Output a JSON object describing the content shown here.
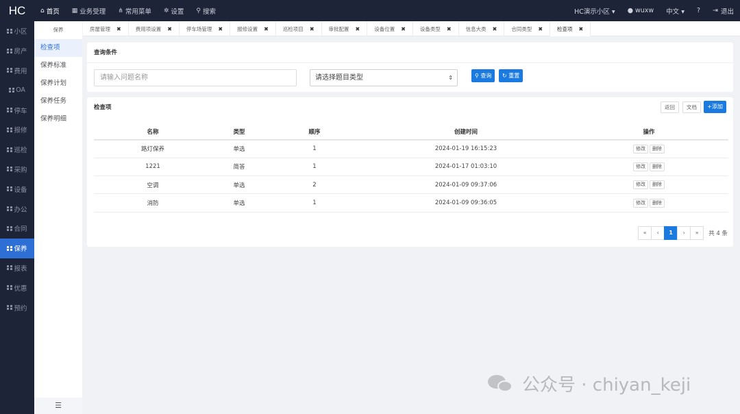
{
  "topbar": {
    "logo": "HC",
    "nav": [
      {
        "icon": "home-icon",
        "glyph": "⌂",
        "label": "首页"
      },
      {
        "icon": "table-icon",
        "glyph": "▦",
        "label": "业务受理"
      },
      {
        "icon": "sitemap-icon",
        "glyph": "⋔",
        "label": "常用菜单"
      },
      {
        "icon": "gear-icon",
        "glyph": "✲",
        "label": "设置"
      },
      {
        "icon": "search-icon",
        "glyph": "⚲",
        "label": "搜索"
      }
    ],
    "community": "HC演示小区 ▾",
    "user": "wuxw",
    "lang": "中文 ▾",
    "help": "?",
    "logout": "退出"
  },
  "sidebar": {
    "items": [
      "小区",
      "房产",
      "费用",
      "OA",
      "停车",
      "报修",
      "巡检",
      "采购",
      "设备",
      "办公",
      "合同",
      "保养",
      "报表",
      "优惠",
      "预约"
    ],
    "active_index": 11
  },
  "submenu": {
    "title": "保养",
    "items": [
      "检查项",
      "保养标准",
      "保养计划",
      "保养任务",
      "保养明细"
    ],
    "active_index": 0,
    "footer_icon": "☰"
  },
  "tabs": [
    "房屋管理",
    "费用项设置",
    "停车场管理",
    "报修设置",
    "巡检项目",
    "审批配置",
    "设备位置",
    "设备类型",
    "信息大类",
    "合同类型",
    "检查项"
  ],
  "query": {
    "title": "查询条件",
    "name_placeholder": "请输入问题名称",
    "type_select": "请选择题目类型",
    "search_label": "查询",
    "reset_label": "重置"
  },
  "list": {
    "title": "检查项",
    "back_label": "返回",
    "doc_label": "文档",
    "add_label": "+添加",
    "columns": [
      "名称",
      "类型",
      "顺序",
      "创建时间",
      "操作"
    ],
    "rows": [
      {
        "name": "路灯保养",
        "type": "单选",
        "order": "1",
        "created": "2024-01-19 16:15:23",
        "edit": "修改",
        "del": "删除"
      },
      {
        "name": "1221",
        "type": "简答",
        "order": "1",
        "created": "2024-01-17 01:03:10",
        "edit": "修改",
        "del": "删除"
      },
      {
        "name": "空调",
        "type": "单选",
        "order": "2",
        "created": "2024-01-09 09:37:06",
        "edit": "修改",
        "del": "删除"
      },
      {
        "name": "消防",
        "type": "单选",
        "order": "1",
        "created": "2024-01-09 09:36:05",
        "edit": "修改",
        "del": "删除"
      }
    ]
  },
  "pagination": {
    "first": "«",
    "prev": "‹",
    "current": "1",
    "next": "›",
    "last": "»",
    "total": "共 4 条"
  },
  "watermark": "公众号 · chiyan_keji"
}
